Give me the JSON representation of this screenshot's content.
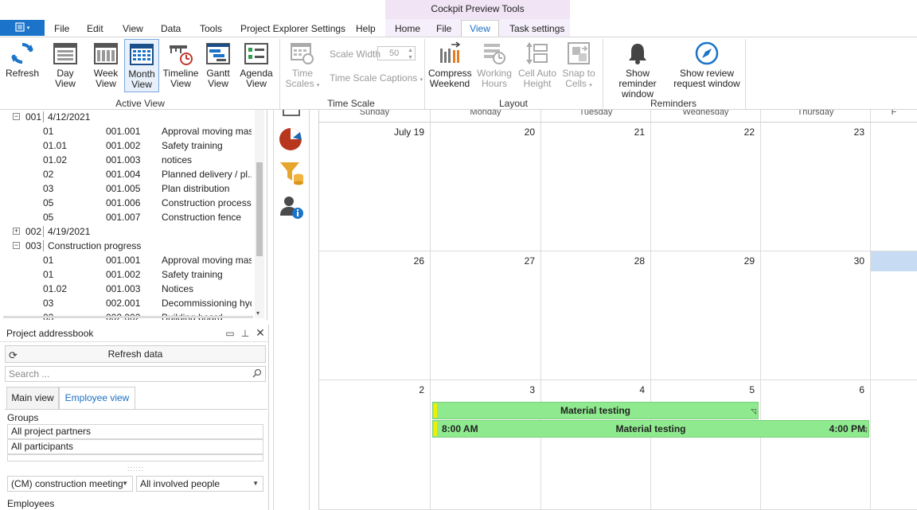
{
  "titlebar": {
    "context_title": "Cockpit Preview Tools"
  },
  "menu": {
    "items": [
      "File",
      "Edit",
      "View",
      "Data",
      "Tools",
      "Project Explorer Settings",
      "Help",
      "Home",
      "File",
      "View",
      "Task settings"
    ]
  },
  "ribbon": {
    "buttons": {
      "refresh": "Refresh",
      "day_view": "Day View",
      "week_view_1": "Week",
      "week_view_2": "View",
      "month_view_1": "Month",
      "month_view_2": "View",
      "timeline_view_1": "Timeline",
      "timeline_view_2": "View",
      "gantt_view_1": "Gantt",
      "gantt_view_2": "View",
      "agenda_view_1": "Agenda",
      "agenda_view_2": "View",
      "time_scales_1": "Time",
      "time_scales_2": "Scales",
      "scale_width_label": "Scale Width",
      "scale_width_value": "50",
      "time_scale_captions": "Time Scale Captions",
      "compress_weekend_1": "Compress",
      "compress_weekend_2": "Weekend",
      "working_hours_1": "Working",
      "working_hours_2": "Hours",
      "cell_auto_height_1": "Cell Auto",
      "cell_auto_height_2": "Height",
      "snap_to_cells_1": "Snap to",
      "snap_to_cells_2": "Cells",
      "reminder_1": "Show reminder",
      "reminder_2": "window",
      "review_1": "Show review",
      "review_2": "request window"
    },
    "groups": [
      "Active View",
      "Time Scale",
      "Layout",
      "Reminders"
    ]
  },
  "tree": {
    "rows": [
      {
        "toggle": "−",
        "a": "001",
        "b": "4/12/2021",
        "c": ""
      },
      {
        "toggle": "",
        "a": "01",
        "b": "001.001",
        "c": "Approval moving masts"
      },
      {
        "toggle": "",
        "a": "01.01",
        "b": "001.002",
        "c": "Safety training"
      },
      {
        "toggle": "",
        "a": "01.02",
        "b": "001.003",
        "c": "notices"
      },
      {
        "toggle": "",
        "a": "02",
        "b": "001.004",
        "c": "Planned delivery / pl..."
      },
      {
        "toggle": "",
        "a": "03",
        "b": "001.005",
        "c": "Plan distribution"
      },
      {
        "toggle": "",
        "a": "05",
        "b": "001.006",
        "c": "Construction process"
      },
      {
        "toggle": "",
        "a": "05",
        "b": "001.007",
        "c": "Construction fence"
      },
      {
        "toggle": "+",
        "a": "002",
        "b": "4/19/2021",
        "c": ""
      },
      {
        "toggle": "−",
        "a": "003",
        "b": "Construction progress",
        "c": ""
      },
      {
        "toggle": "",
        "a": "01",
        "b": "001.001",
        "c": "Approval moving masts"
      },
      {
        "toggle": "",
        "a": "01",
        "b": "001.002",
        "c": "Safety training"
      },
      {
        "toggle": "",
        "a": "01.02",
        "b": "001.003",
        "c": "Notices"
      },
      {
        "toggle": "",
        "a": "03",
        "b": "002.001",
        "c": "Decommissioning hyd..."
      },
      {
        "toggle": "",
        "a": "03",
        "b": "002.002",
        "c": "Building board"
      }
    ]
  },
  "addressbook": {
    "title": "Project addressbook",
    "refresh_label": "Refresh data",
    "search_placeholder": "Search ...",
    "tabs": [
      "Main view",
      "Employee view"
    ],
    "groups_label": "Groups",
    "groups": [
      "All project partners",
      "All participants"
    ],
    "dropdown_meeting": "(CM) construction meeting",
    "dropdown_people": "All involved people",
    "employees_label": "Employees"
  },
  "calendar": {
    "day_headers": [
      "Sunday",
      "Monday",
      "Tuesday",
      "Wednesday",
      "Thursday",
      "F"
    ],
    "weeks": [
      [
        "July 19",
        "20",
        "21",
        "22",
        "23"
      ],
      [
        "26",
        "27",
        "28",
        "29",
        "30"
      ],
      [
        "2",
        "3",
        "4",
        "5",
        "6"
      ]
    ],
    "appointments": [
      {
        "title": "Material testing",
        "start": "",
        "end": ""
      },
      {
        "title": "Material testing",
        "start": "8:00 AM",
        "end": "4:00 PM"
      }
    ]
  },
  "colors": {
    "accent": "#1b74c9",
    "appointment_green": "#8fea8f",
    "appointment_bar": "#f0f000",
    "context_tab": "#f0e4f5",
    "selection": "#c7dcf2"
  }
}
